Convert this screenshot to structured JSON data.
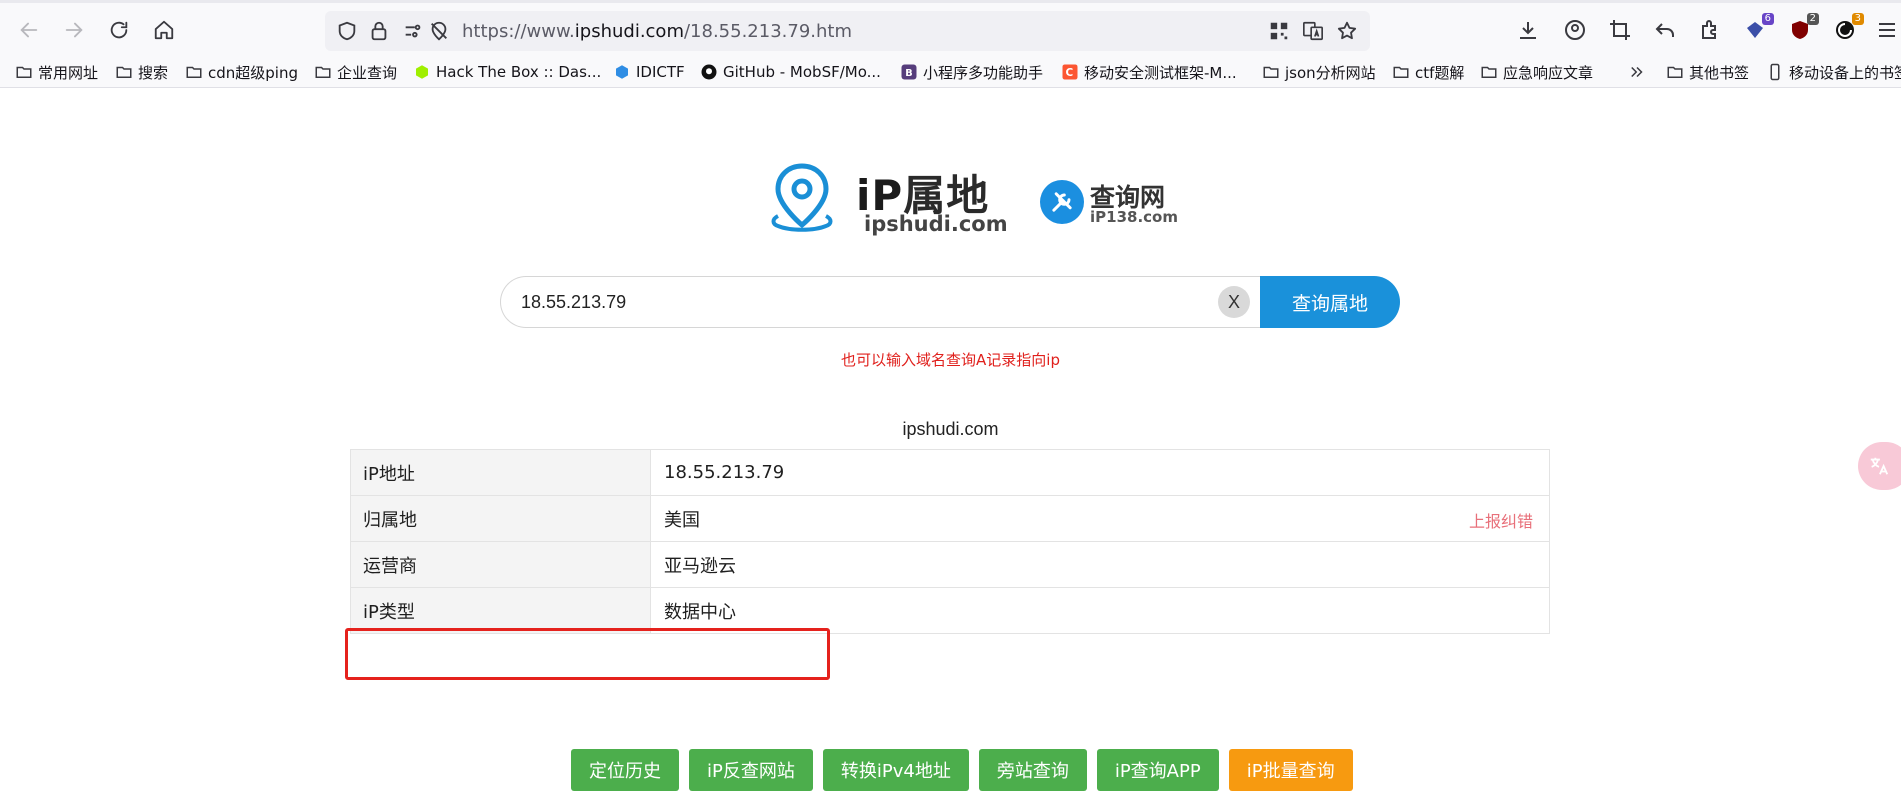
{
  "browser": {
    "url_prefix": "https://www.",
    "url_host": "ipshudi.com",
    "url_path": "/18.55.213.79.htm",
    "badges": {
      "ext1": "6",
      "ext2": "2",
      "ext3": "3"
    },
    "bookmarks": [
      {
        "label": "常用网址",
        "icon": "folder-icon"
      },
      {
        "label": "搜索",
        "icon": "folder-icon"
      },
      {
        "label": "cdn超级ping",
        "icon": "folder-icon"
      },
      {
        "label": "企业查询",
        "icon": "folder-icon"
      },
      {
        "label": "Hack The Box :: Das...",
        "icon": "htb-icon"
      },
      {
        "label": "IDICTF",
        "icon": "idictf-icon"
      },
      {
        "label": "GitHub - MobSF/Mo...",
        "icon": "github-icon"
      },
      {
        "label": "小程序多功能助手",
        "icon": "bootstrap-icon"
      },
      {
        "label": "移动安全测试框架-M...",
        "icon": "csdn-icon"
      },
      {
        "label": "json分析网站",
        "icon": "folder-icon"
      },
      {
        "label": "ctf题解",
        "icon": "folder-icon"
      },
      {
        "label": "应急响应文章",
        "icon": "folder-icon"
      },
      {
        "label": "其他书签",
        "icon": "folder-icon"
      },
      {
        "label": "移动设备上的书签",
        "icon": "mobile-icon"
      }
    ]
  },
  "logo": {
    "title_ip": "iP",
    "title_rest": "属地",
    "subtitle": "ipshudi.com",
    "partner_title": "查询网",
    "partner_sub": "iP138.com"
  },
  "search": {
    "value": "18.55.213.79",
    "clear_label": "X",
    "button_label": "查询属地"
  },
  "hint": "也可以输入域名查询A记录指向ip",
  "site_label": "ipshudi.com",
  "table": {
    "rows": [
      {
        "key": "iP地址",
        "value": "18.55.213.79"
      },
      {
        "key": "归属地",
        "value": "美国"
      },
      {
        "key": "运营商",
        "value": "亚马逊云"
      },
      {
        "key": "iP类型",
        "value": "数据中心"
      }
    ],
    "report_label": "上报纠错"
  },
  "actions": [
    {
      "label": "定位历史"
    },
    {
      "label": "iP反查网站"
    },
    {
      "label": "转换iPv4地址"
    },
    {
      "label": "旁站查询"
    },
    {
      "label": "iP查询APP"
    },
    {
      "label": "iP批量查询"
    }
  ],
  "colors": {
    "primary": "#1a91da",
    "green": "#4cae4c",
    "orange": "#f79a10",
    "highlight": "#e5221d",
    "hint": "#e0201c"
  }
}
